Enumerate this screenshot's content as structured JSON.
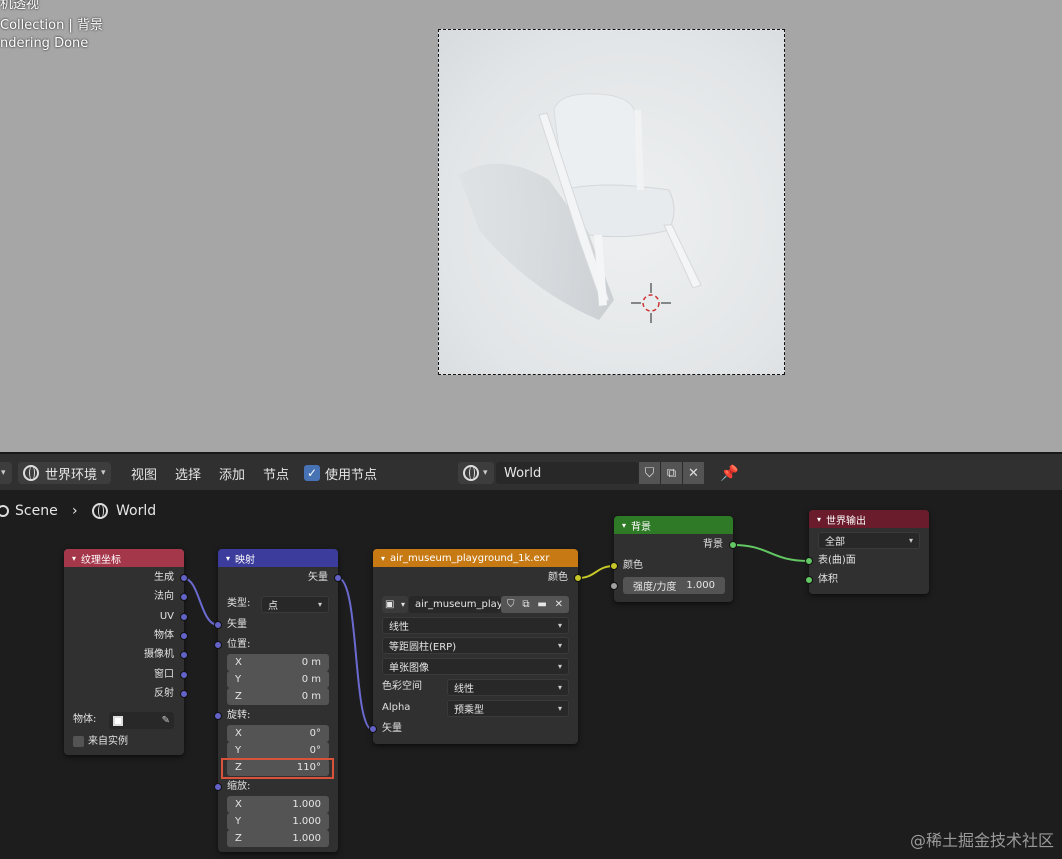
{
  "viewport": {
    "lines": [
      "机透视",
      "Collection | 背景",
      "ndering Done"
    ]
  },
  "header": {
    "editor_type": "世界环境",
    "menu": [
      "视图",
      "选择",
      "添加",
      "节点"
    ],
    "use_nodes_label": "使用节点",
    "world_name": "World"
  },
  "breadcrumb": {
    "scene": "Scene",
    "world": "World"
  },
  "nodes": {
    "texcoord": {
      "title": "纹理坐标",
      "outputs": [
        "生成",
        "法向",
        "UV",
        "物体",
        "摄像机",
        "窗口",
        "反射"
      ],
      "object_label": "物体:",
      "from_instancer_label": "来自实例"
    },
    "mapping": {
      "title": "映射",
      "output_vector": "矢量",
      "type_label": "类型:",
      "type_value": "点",
      "input_vector": "矢量",
      "location_label": "位置:",
      "location": [
        [
          "X",
          "0 m"
        ],
        [
          "Y",
          "0 m"
        ],
        [
          "Z",
          "0 m"
        ]
      ],
      "rotation_label": "旋转:",
      "rotation": [
        [
          "X",
          "0°"
        ],
        [
          "Y",
          "0°"
        ],
        [
          "Z",
          "110°"
        ]
      ],
      "scale_label": "缩放:",
      "scale": [
        [
          "X",
          "1.000"
        ],
        [
          "Y",
          "1.000"
        ],
        [
          "Z",
          "1.000"
        ]
      ]
    },
    "envtex": {
      "title": "air_museum_playground_1k.exr",
      "output_color": "颜色",
      "image_name": "air_museum_play...",
      "interpolation": "线性",
      "projection": "等距圆柱(ERP)",
      "source": "单张图像",
      "colorspace_label": "色彩空间",
      "colorspace_value": "线性",
      "alpha_label": "Alpha",
      "alpha_value": "预乘型",
      "input_vector": "矢量"
    },
    "background": {
      "title": "背景",
      "output": "背景",
      "color_label": "颜色",
      "strength_label": "强度/力度",
      "strength_value": "1.000"
    },
    "world_output": {
      "title": "世界输出",
      "target": "全部",
      "surface": "表(曲)面",
      "volume": "体积"
    }
  },
  "watermark": "@稀土掘金技术社区",
  "colors": {
    "texcoord_header": "#a5374b",
    "mapping_header": "#3c3c9c",
    "envtex_header": "#c77a13",
    "background_header": "#2e7a26",
    "output_header": "#6b1c2c",
    "highlight": "#d9533a"
  }
}
